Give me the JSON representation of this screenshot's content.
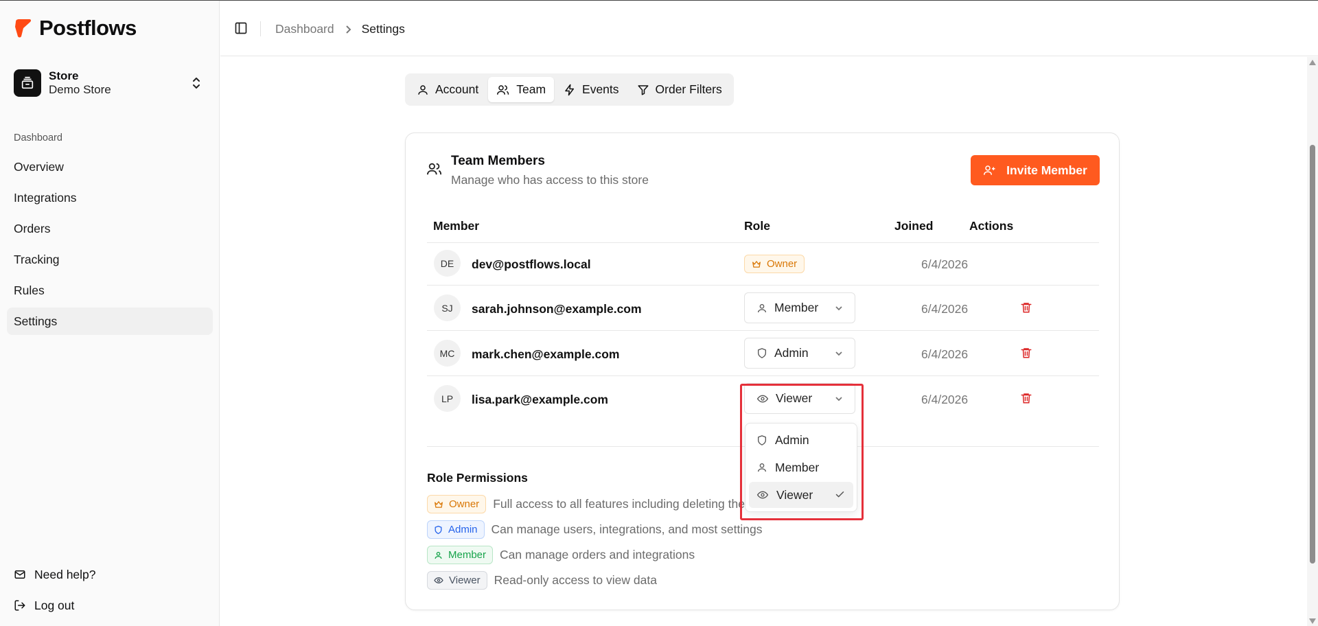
{
  "brand": {
    "name": "Postflows"
  },
  "store": {
    "name": "Store",
    "subtitle": "Demo Store"
  },
  "sidebar": {
    "section_label": "Dashboard",
    "items": [
      {
        "label": "Overview"
      },
      {
        "label": "Integrations"
      },
      {
        "label": "Orders"
      },
      {
        "label": "Tracking"
      },
      {
        "label": "Rules"
      },
      {
        "label": "Settings"
      }
    ],
    "help_label": "Need help?",
    "logout_label": "Log out"
  },
  "breadcrumb": {
    "parent": "Dashboard",
    "current": "Settings"
  },
  "tabs": [
    {
      "label": "Account"
    },
    {
      "label": "Team"
    },
    {
      "label": "Events"
    },
    {
      "label": "Order Filters"
    }
  ],
  "team": {
    "title": "Team Members",
    "subtitle": "Manage who has access to this store",
    "invite_label": "Invite Member",
    "columns": {
      "member": "Member",
      "role": "Role",
      "joined": "Joined",
      "actions": "Actions"
    },
    "members": [
      {
        "initials": "DE",
        "email": "dev@postflows.local",
        "role": "Owner",
        "joined": "6/4/2026"
      },
      {
        "initials": "SJ",
        "email": "sarah.johnson@example.com",
        "role": "Member",
        "joined": "6/4/2026"
      },
      {
        "initials": "MC",
        "email": "mark.chen@example.com",
        "role": "Admin",
        "joined": "6/4/2026"
      },
      {
        "initials": "LP",
        "email": "lisa.park@example.com",
        "role": "Viewer",
        "joined": "6/4/2026"
      }
    ],
    "role_options": [
      {
        "label": "Admin"
      },
      {
        "label": "Member"
      },
      {
        "label": "Viewer"
      }
    ]
  },
  "permissions": {
    "title": "Role Permissions",
    "rows": [
      {
        "role": "Owner",
        "description": "Full access to all features including deleting the"
      },
      {
        "role": "Admin",
        "description": "Can manage users, integrations, and most settings"
      },
      {
        "role": "Member",
        "description": "Can manage orders and integrations"
      },
      {
        "role": "Viewer",
        "description": "Read-only access to view data"
      }
    ]
  },
  "colors": {
    "accent": "#ff5a1f",
    "danger": "#dc2626",
    "highlight": "#e5303a",
    "owner": "#d97706",
    "admin": "#2563eb",
    "member": "#16a34a",
    "viewer": "#4b5563"
  }
}
